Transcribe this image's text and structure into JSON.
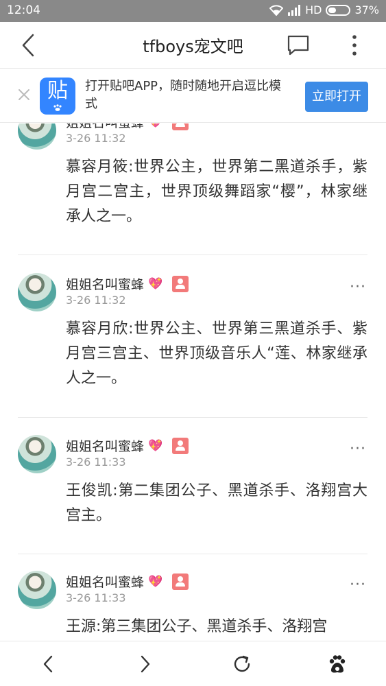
{
  "status_bar": {
    "time": "12:04",
    "network": "HD",
    "battery": "37%"
  },
  "header": {
    "title": "tfboys宠文吧",
    "icons": [
      "back-arrow-icon",
      "reply-bubble-icon",
      "more-vertical-icon"
    ]
  },
  "banner": {
    "logo_glyph": "贴",
    "message": "打开贴吧APP，随时随地开启逗比模式",
    "open_button": "立即打开"
  },
  "posts": [
    {
      "author": "姐姐名叫蜜蜂",
      "time": "3-26 11:32",
      "content": "慕容月筱:世界公主，世界第二黑道杀手，紫月宫二宫主，世界顶级舞蹈家“樱”，林家继承人之一。",
      "more": "···"
    },
    {
      "author": "姐姐名叫蜜蜂",
      "time": "3-26 11:32",
      "content": "慕容月欣:世界公主、世界第三黑道杀手、紫月宫三宫主、世界顶级音乐人“莲、林家继承人之一。",
      "more": "···"
    },
    {
      "author": "姐姐名叫蜜蜂",
      "time": "3-26 11:33",
      "content": "王俊凯:第二集团公子、黑道杀手、洛翔宫大宫主。",
      "more": "···"
    },
    {
      "author": "姐姐名叫蜜蜂",
      "time": "3-26 11:33",
      "content": "王源:第三集团公子、黑道杀手、洛翔宫",
      "more": "···"
    }
  ],
  "post_badges": {
    "heart_glyph": "💖"
  },
  "bottom_nav": {
    "icons": [
      "back-icon",
      "forward-icon",
      "refresh-icon",
      "baidu-paw-icon"
    ]
  },
  "colors": {
    "status_bar": "#898989",
    "accent_blue": "#3c8be6",
    "badge_red": "#f27a7a"
  }
}
